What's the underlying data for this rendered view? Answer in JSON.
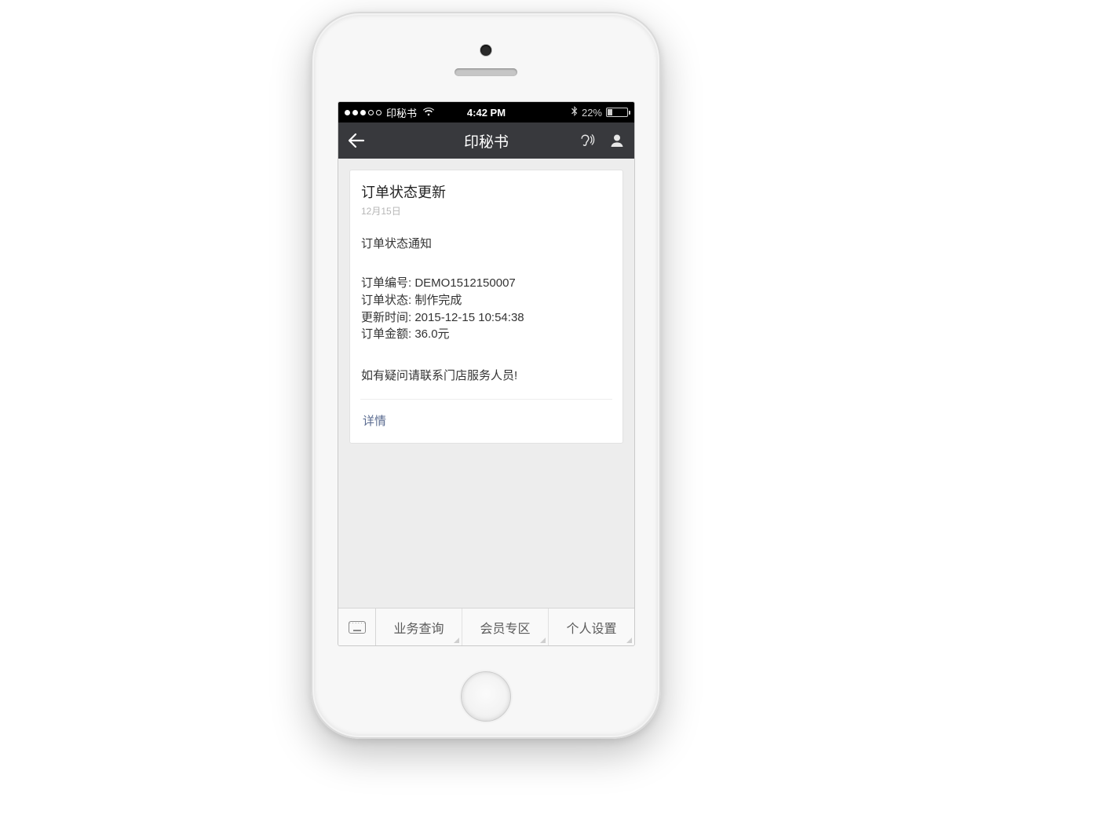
{
  "status_bar": {
    "signal_count_on": 3,
    "signal_count_total": 5,
    "carrier": "印秘书",
    "time": "4:42 PM",
    "battery_pct": "22%"
  },
  "nav": {
    "title": "印秘书"
  },
  "card": {
    "title": "订单状态更新",
    "date": "12月15日",
    "subtitle": "订单状态通知",
    "fields": {
      "order_no_label": "订单编号:",
      "order_no": "DEMO1512150007",
      "status_label": "订单状态:",
      "status": "制作完成",
      "update_label": "更新时间:",
      "update": "2015-12-15 10:54:38",
      "amount_label": "订单金额:",
      "amount": "36.0元"
    },
    "footnote": "如有疑问请联系门店服务人员!",
    "link": "详情"
  },
  "tabs": {
    "items": [
      {
        "label": "业务查询"
      },
      {
        "label": "会员专区"
      },
      {
        "label": "个人设置"
      }
    ]
  }
}
